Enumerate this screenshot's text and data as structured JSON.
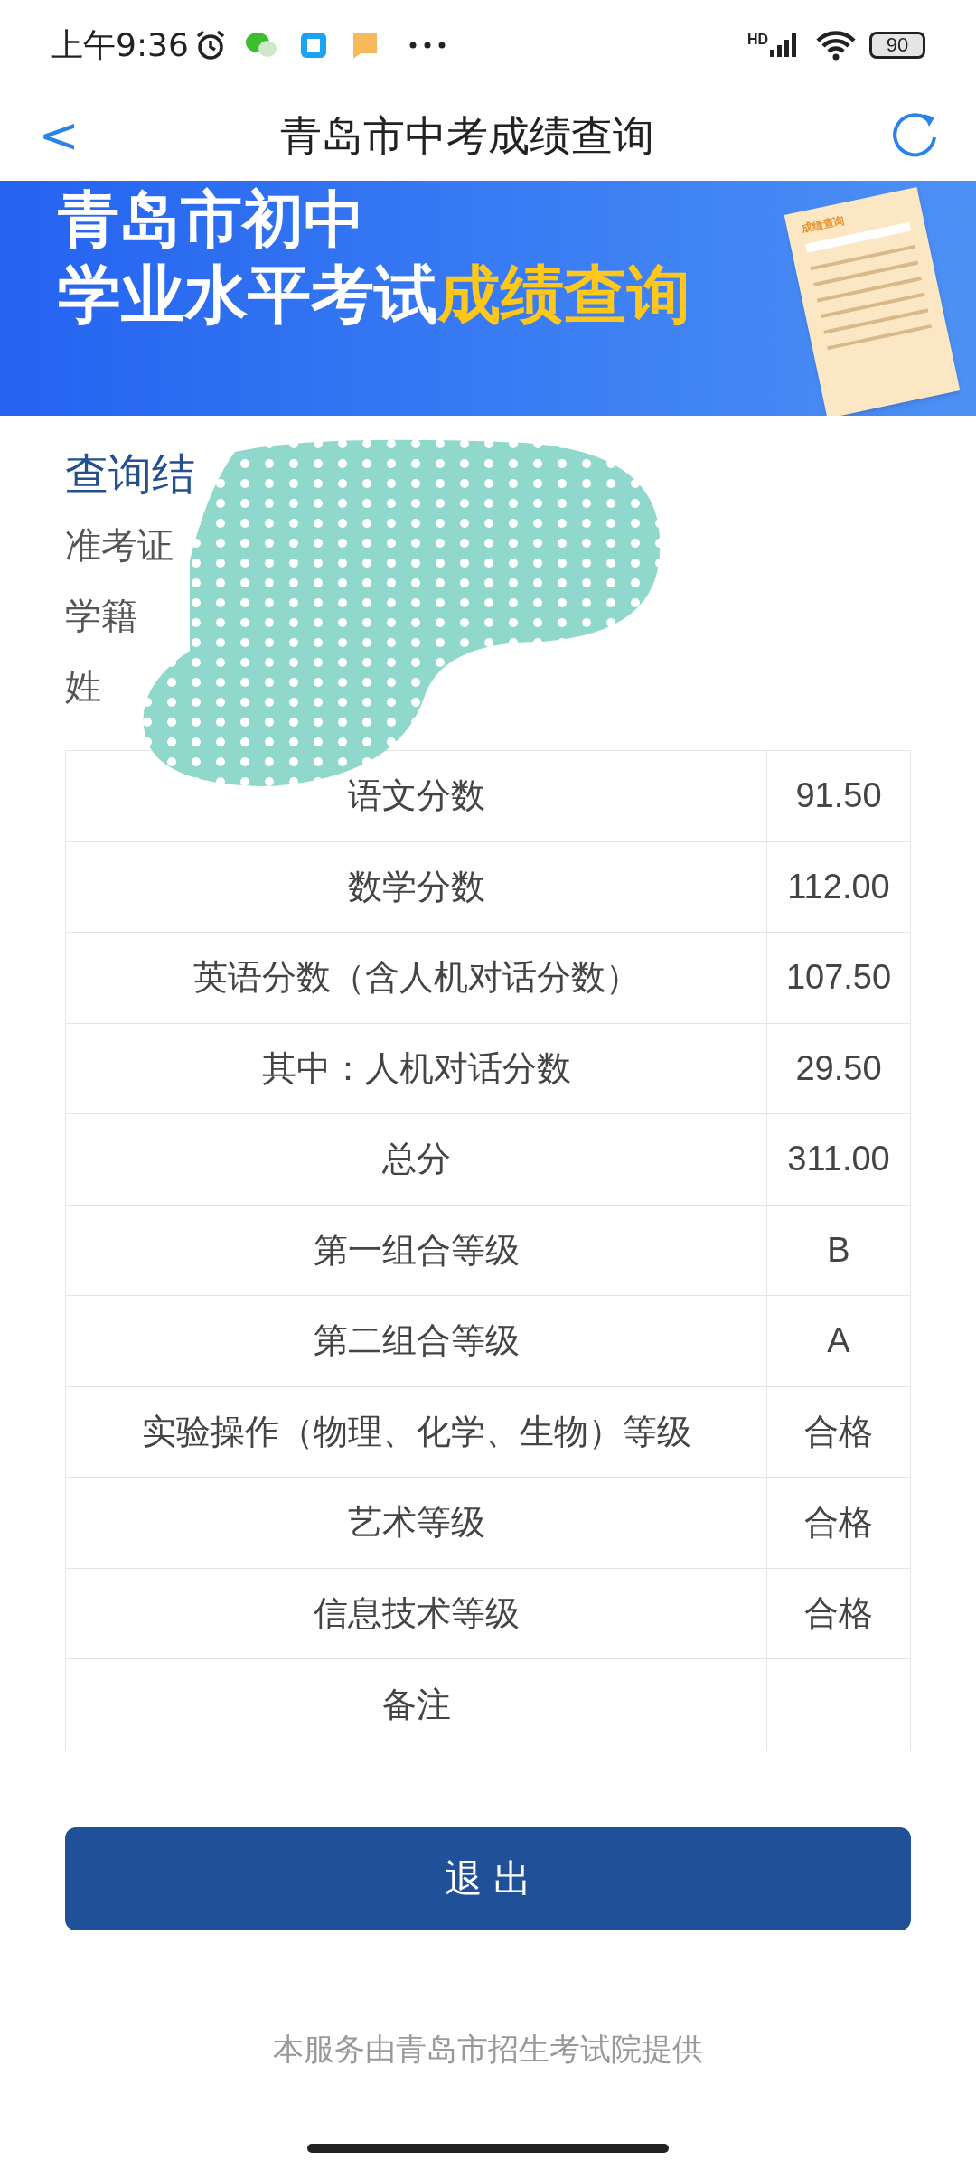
{
  "status_bar": {
    "time": "上午9:36",
    "network": "HD",
    "battery": "90"
  },
  "header": {
    "back": "<",
    "title": "青岛市中考成绩查询"
  },
  "banner": {
    "line_1": "青岛市初中",
    "line_2_white": "学业水平考试",
    "line_2_yellow": "成绩查询",
    "paper_label": "成绩查询"
  },
  "result": {
    "title": "查询结",
    "fields": [
      "准考证",
      "学籍",
      "姓"
    ]
  },
  "table": {
    "rows": [
      {
        "label": "语文分数",
        "value": "91.50"
      },
      {
        "label": "数学分数",
        "value": "112.00"
      },
      {
        "label": "英语分数（含人机对话分数）",
        "value": "107.50"
      },
      {
        "label": "其中：人机对话分数",
        "value": "29.50"
      },
      {
        "label": "总分",
        "value": "311.00"
      },
      {
        "label": "第一组合等级",
        "value": "B"
      },
      {
        "label": "第二组合等级",
        "value": "A"
      },
      {
        "label": "实验操作（物理、化学、生物）等级",
        "value": "合格"
      },
      {
        "label": "艺术等级",
        "value": "合格"
      },
      {
        "label": "信息技术等级",
        "value": "合格"
      },
      {
        "label": "备注"
      }
    ]
  },
  "exit_button": "退 出",
  "footer": "本服务由青岛市招生考试院提供"
}
